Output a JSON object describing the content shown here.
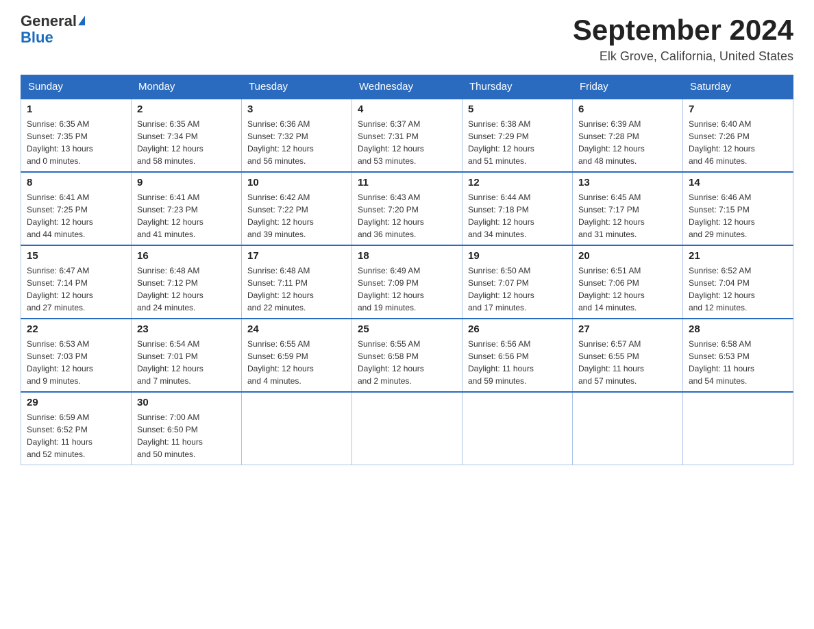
{
  "header": {
    "logo_text_general": "General",
    "logo_text_blue": "Blue",
    "month_year": "September 2024",
    "location": "Elk Grove, California, United States"
  },
  "days_of_week": [
    "Sunday",
    "Monday",
    "Tuesday",
    "Wednesday",
    "Thursday",
    "Friday",
    "Saturday"
  ],
  "weeks": [
    [
      {
        "day": "1",
        "sunrise": "6:35 AM",
        "sunset": "7:35 PM",
        "daylight": "13 hours and 0 minutes."
      },
      {
        "day": "2",
        "sunrise": "6:35 AM",
        "sunset": "7:34 PM",
        "daylight": "12 hours and 58 minutes."
      },
      {
        "day": "3",
        "sunrise": "6:36 AM",
        "sunset": "7:32 PM",
        "daylight": "12 hours and 56 minutes."
      },
      {
        "day": "4",
        "sunrise": "6:37 AM",
        "sunset": "7:31 PM",
        "daylight": "12 hours and 53 minutes."
      },
      {
        "day": "5",
        "sunrise": "6:38 AM",
        "sunset": "7:29 PM",
        "daylight": "12 hours and 51 minutes."
      },
      {
        "day": "6",
        "sunrise": "6:39 AM",
        "sunset": "7:28 PM",
        "daylight": "12 hours and 48 minutes."
      },
      {
        "day": "7",
        "sunrise": "6:40 AM",
        "sunset": "7:26 PM",
        "daylight": "12 hours and 46 minutes."
      }
    ],
    [
      {
        "day": "8",
        "sunrise": "6:41 AM",
        "sunset": "7:25 PM",
        "daylight": "12 hours and 44 minutes."
      },
      {
        "day": "9",
        "sunrise": "6:41 AM",
        "sunset": "7:23 PM",
        "daylight": "12 hours and 41 minutes."
      },
      {
        "day": "10",
        "sunrise": "6:42 AM",
        "sunset": "7:22 PM",
        "daylight": "12 hours and 39 minutes."
      },
      {
        "day": "11",
        "sunrise": "6:43 AM",
        "sunset": "7:20 PM",
        "daylight": "12 hours and 36 minutes."
      },
      {
        "day": "12",
        "sunrise": "6:44 AM",
        "sunset": "7:18 PM",
        "daylight": "12 hours and 34 minutes."
      },
      {
        "day": "13",
        "sunrise": "6:45 AM",
        "sunset": "7:17 PM",
        "daylight": "12 hours and 31 minutes."
      },
      {
        "day": "14",
        "sunrise": "6:46 AM",
        "sunset": "7:15 PM",
        "daylight": "12 hours and 29 minutes."
      }
    ],
    [
      {
        "day": "15",
        "sunrise": "6:47 AM",
        "sunset": "7:14 PM",
        "daylight": "12 hours and 27 minutes."
      },
      {
        "day": "16",
        "sunrise": "6:48 AM",
        "sunset": "7:12 PM",
        "daylight": "12 hours and 24 minutes."
      },
      {
        "day": "17",
        "sunrise": "6:48 AM",
        "sunset": "7:11 PM",
        "daylight": "12 hours and 22 minutes."
      },
      {
        "day": "18",
        "sunrise": "6:49 AM",
        "sunset": "7:09 PM",
        "daylight": "12 hours and 19 minutes."
      },
      {
        "day": "19",
        "sunrise": "6:50 AM",
        "sunset": "7:07 PM",
        "daylight": "12 hours and 17 minutes."
      },
      {
        "day": "20",
        "sunrise": "6:51 AM",
        "sunset": "7:06 PM",
        "daylight": "12 hours and 14 minutes."
      },
      {
        "day": "21",
        "sunrise": "6:52 AM",
        "sunset": "7:04 PM",
        "daylight": "12 hours and 12 minutes."
      }
    ],
    [
      {
        "day": "22",
        "sunrise": "6:53 AM",
        "sunset": "7:03 PM",
        "daylight": "12 hours and 9 minutes."
      },
      {
        "day": "23",
        "sunrise": "6:54 AM",
        "sunset": "7:01 PM",
        "daylight": "12 hours and 7 minutes."
      },
      {
        "day": "24",
        "sunrise": "6:55 AM",
        "sunset": "6:59 PM",
        "daylight": "12 hours and 4 minutes."
      },
      {
        "day": "25",
        "sunrise": "6:55 AM",
        "sunset": "6:58 PM",
        "daylight": "12 hours and 2 minutes."
      },
      {
        "day": "26",
        "sunrise": "6:56 AM",
        "sunset": "6:56 PM",
        "daylight": "11 hours and 59 minutes."
      },
      {
        "day": "27",
        "sunrise": "6:57 AM",
        "sunset": "6:55 PM",
        "daylight": "11 hours and 57 minutes."
      },
      {
        "day": "28",
        "sunrise": "6:58 AM",
        "sunset": "6:53 PM",
        "daylight": "11 hours and 54 minutes."
      }
    ],
    [
      {
        "day": "29",
        "sunrise": "6:59 AM",
        "sunset": "6:52 PM",
        "daylight": "11 hours and 52 minutes."
      },
      {
        "day": "30",
        "sunrise": "7:00 AM",
        "sunset": "6:50 PM",
        "daylight": "11 hours and 50 minutes."
      },
      null,
      null,
      null,
      null,
      null
    ]
  ],
  "labels": {
    "sunrise": "Sunrise:",
    "sunset": "Sunset:",
    "daylight": "Daylight:"
  }
}
